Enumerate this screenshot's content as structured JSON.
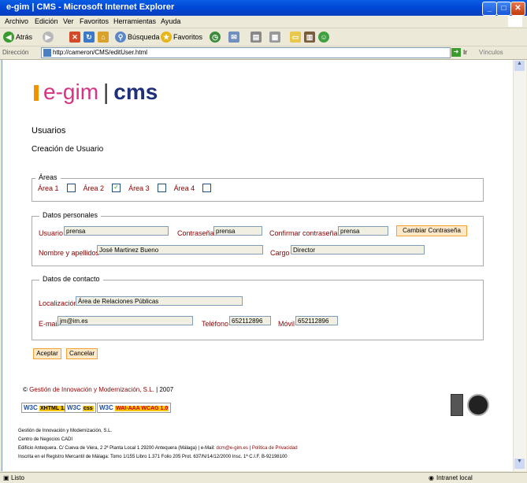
{
  "window": {
    "title": "e-gim | CMS - Microsoft Internet Explorer",
    "minimize": "_",
    "maximize": "□",
    "close": "✕"
  },
  "menu": [
    "Archivo",
    "Edición",
    "Ver",
    "Favoritos",
    "Herramientas",
    "Ayuda"
  ],
  "toolbar": {
    "back": "Atrás",
    "search": "Búsqueda",
    "favorites": "Favoritos"
  },
  "address": {
    "label": "Dirección",
    "url": "http://cameron/CMS/editUser.html",
    "go": "Ir",
    "links": "Vínculos"
  },
  "logo": {
    "left": "e-gim",
    "sep": "|",
    "right": "cms"
  },
  "page": {
    "heading": "Usuarios",
    "subheading": "Creación de Usuario"
  },
  "areas": {
    "legend": "Áreas",
    "items": [
      {
        "label": "Área 1",
        "checked": false
      },
      {
        "label": "Área 2",
        "checked": true
      },
      {
        "label": "Área 3",
        "checked": false
      },
      {
        "label": "Área 4",
        "checked": false
      }
    ]
  },
  "personal": {
    "legend": "Datos personales",
    "usuario_label": "Usuario",
    "usuario_value": "prensa",
    "pass_label": "Contraseña",
    "pass_value": "prensa",
    "confirm_label": "Confirmar contraseña",
    "confirm_value": "prensa",
    "change_pass": "Cambiar Contraseña",
    "name_label": "Nombre y apellidos",
    "name_value": "José Martinez Bueno",
    "cargo_label": "Cargo",
    "cargo_value": "Director"
  },
  "contact": {
    "legend": "Datos de contacto",
    "loc_label": "Localización",
    "loc_value": "Área de Relaciones Públicas",
    "email_label": "E-mail",
    "email_value": "jm@im.es",
    "tel_label": "Teléfono",
    "tel_value": "652112896",
    "movil_label": "Móvil",
    "movil_value": "652112896"
  },
  "actions": {
    "accept": "Aceptar",
    "cancel": "Cancelar"
  },
  "footer": {
    "copyright": "©",
    "company": "Gestión de Innovación y Modernización, S.L.",
    "sep": "|",
    "year": "2007",
    "badges": {
      "xhtml": "XHTML 1.0",
      "css": "css",
      "wai": "WAI-AAA WCAG 1.0",
      "w3c": "W3C"
    },
    "line1": "Gestión de Innovación y Modernización, S.L.",
    "line2": "Centro de Negocios CADI",
    "line3": "Edificio Antequera. C/ Cueva de Viera, 2 2ª Planta Local 1 29200 Antequera (Málaga) | e-Mail: ",
    "email": "dcm@e-gim.es",
    "policy": "Política de Privacidad",
    "line4": "Inscrita en el Registro Mercantil de Málaga: Tomo 1/155 Libro 1.371 Folio 205 Prot. 637/N/14/12/2000 Insc. 1ª C.I.F. B-92198100"
  },
  "status": {
    "left": "Listo",
    "right": "Intranet local"
  }
}
